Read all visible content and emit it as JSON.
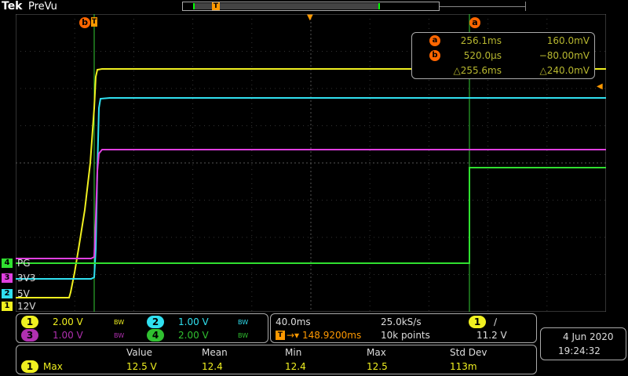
{
  "header": {
    "brand": "Tek",
    "mode": "PreVu",
    "record_marker": "T"
  },
  "colors": {
    "ch1": "#f0f020",
    "ch2": "#30e0f0",
    "ch3": "#e040e0",
    "ch4": "#30e030",
    "accent": "#ff9900",
    "cursor": "#ff6600"
  },
  "cursors": {
    "marker_a": "a",
    "marker_b": "b",
    "trigger_marker": "T",
    "readout": [
      {
        "marker": "a",
        "time": "256.1ms",
        "value": "160.0mV"
      },
      {
        "marker": "b",
        "time": "520.0µs",
        "value": "−80.00mV"
      },
      {
        "marker": "",
        "time": "△255.6ms",
        "value": "△240.0mV"
      }
    ]
  },
  "channels": [
    {
      "num": "4",
      "label": "PG",
      "scale": "2.00 V",
      "bw": "BW"
    },
    {
      "num": "3",
      "label": "3V3",
      "scale": "1.00 V",
      "bw": "BW"
    },
    {
      "num": "2",
      "label": "5V",
      "scale": "1.00 V",
      "bw": "BW"
    },
    {
      "num": "1",
      "label": "12V",
      "scale": "2.00 V",
      "bw": "BW"
    }
  ],
  "timebase": {
    "scale": "40.0ms",
    "sample_rate": "25.0kS/s",
    "trigger_pos": "148.9200ms",
    "record_length": "10k points",
    "trigger_channel": "1",
    "trigger_slope": "∕",
    "trigger_level": "11.2 V"
  },
  "date": {
    "day": "4 Jun  2020",
    "time": "19:24:32"
  },
  "measurement": {
    "headers": [
      "Value",
      "Mean",
      "Min",
      "Max",
      "Std Dev"
    ],
    "channel": "1",
    "name": "Max",
    "values": [
      "12.5 V",
      "12.4",
      "12.4",
      "12.5",
      "113m"
    ]
  }
}
